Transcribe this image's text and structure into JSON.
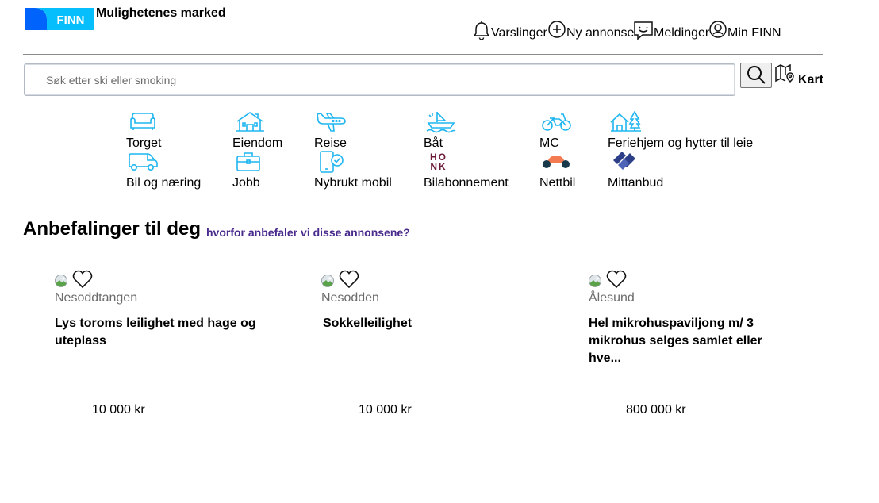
{
  "header": {
    "logo_text": "FINN",
    "tagline": "Mulighetenes marked",
    "nav": [
      {
        "label": "Varslinger",
        "icon": "bell-icon"
      },
      {
        "label": "Ny annonse",
        "icon": "plus-circle-icon"
      },
      {
        "label": "Meldinger",
        "icon": "chat-icon"
      },
      {
        "label": "Min FINN",
        "icon": "user-circle-icon"
      }
    ]
  },
  "search": {
    "placeholder": "Søk etter ski eller smoking",
    "value": "",
    "map_label": "Kart"
  },
  "categories": [
    {
      "label": "Torget",
      "icon": "sofa-icon"
    },
    {
      "label": "Eiendom",
      "icon": "house-icon"
    },
    {
      "label": "Reise",
      "icon": "plane-icon"
    },
    {
      "label": "Båt",
      "icon": "boat-icon"
    },
    {
      "label": "MC",
      "icon": "motorcycle-icon"
    },
    {
      "label": "Feriehjem og hytter til leie",
      "icon": "cabin-icon"
    },
    {
      "label": "Bil og næring",
      "icon": "van-icon"
    },
    {
      "label": "Jobb",
      "icon": "briefcase-icon"
    },
    {
      "label": "Nybrukt mobil",
      "icon": "phone-check-icon"
    },
    {
      "label": "Bilabonnement",
      "icon": "honk-logo",
      "logo_text": "HONK"
    },
    {
      "label": "Nettbil",
      "icon": "nettbil-logo"
    },
    {
      "label": "Mittanbud",
      "icon": "handshake-logo"
    }
  ],
  "recommendations": {
    "title": "Anbefalinger til deg",
    "why_link": "hvorfor anbefaler vi disse annonsene?",
    "items": [
      {
        "location": "Nesoddtangen",
        "title": "Lys toroms leilighet med hage og uteplass",
        "price": "10 000 kr"
      },
      {
        "location": "Nesodden",
        "title": "Sokkelleilighet",
        "price": "10 000 kr"
      },
      {
        "location": "Ålesund",
        "title": "Hel mikrohuspaviljong m/ 3 mikrohus selges samlet eller hve...",
        "price": "800 000 kr"
      }
    ]
  },
  "colors": {
    "finn_blue": "#06befb",
    "finn_dark_blue": "#0063fb",
    "category_icon": "#1fb6f0",
    "link_purple": "#4a2a8c",
    "honk_maroon": "#6b1a3a",
    "nettbil_orange": "#f47b51",
    "mittanbud_navy": "#2c3e87"
  }
}
